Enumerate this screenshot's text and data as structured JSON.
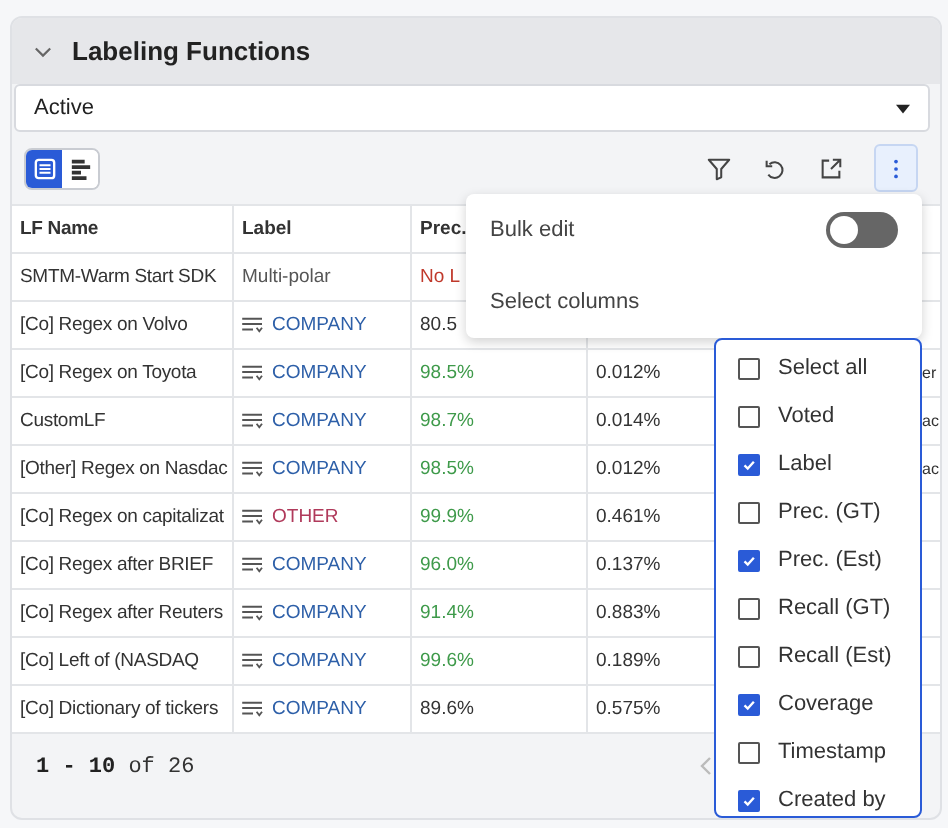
{
  "panel": {
    "title": "Labeling Functions"
  },
  "filter": {
    "value": "Active"
  },
  "view_toggle": [
    {
      "selected": true
    },
    {
      "selected": false
    }
  ],
  "table": {
    "columns": [
      "LF Name",
      "Label",
      "Prec."
    ],
    "rows": [
      {
        "name": "SMTM-Warm Start SDK",
        "label": {
          "text": "Multi-polar",
          "kind": "plain",
          "color": "#555555"
        },
        "prec": {
          "text": "No L",
          "color": "#c0392b"
        }
      },
      {
        "name": "[Co] Regex on Volvo",
        "label": {
          "text": "COMPANY",
          "kind": "tag",
          "color": "#2d5fa8"
        },
        "prec": {
          "text": "80.5",
          "color": "#333333"
        }
      },
      {
        "name": "[Co] Regex on Toyota",
        "label": {
          "text": "COMPANY",
          "kind": "tag",
          "color": "#2d5fa8"
        },
        "prec": {
          "text": "98.5%",
          "color": "#3e9a4a"
        },
        "column_4": "0.012%",
        "column_5": "er"
      },
      {
        "name": "CustomLF",
        "label": {
          "text": "COMPANY",
          "kind": "tag",
          "color": "#2d5fa8"
        },
        "prec": {
          "text": "98.7%",
          "color": "#3e9a4a"
        },
        "column_4": "0.014%",
        "column_5": "ac"
      },
      {
        "name": "[Other] Regex on Nasdac",
        "label": {
          "text": "COMPANY",
          "kind": "tag",
          "color": "#2d5fa8"
        },
        "prec": {
          "text": "98.5%",
          "color": "#3e9a4a"
        },
        "column_4": "0.012%",
        "column_5": "ac"
      },
      {
        "name": "[Co] Regex on capitalizat",
        "label": {
          "text": "OTHER",
          "kind": "tag",
          "color": "#b03a5b"
        },
        "prec": {
          "text": "99.9%",
          "color": "#3e9a4a"
        },
        "column_4": "0.461%"
      },
      {
        "name": "[Co] Regex after BRIEF",
        "label": {
          "text": "COMPANY",
          "kind": "tag",
          "color": "#2d5fa8"
        },
        "prec": {
          "text": "96.0%",
          "color": "#3e9a4a"
        },
        "column_4": "0.137%"
      },
      {
        "name": "[Co] Regex after Reuters",
        "label": {
          "text": "COMPANY",
          "kind": "tag",
          "color": "#2d5fa8"
        },
        "prec": {
          "text": "91.4%",
          "color": "#3e9a4a"
        },
        "column_4": "0.883%"
      },
      {
        "name": "[Co] Left of (NASDAQ",
        "label": {
          "text": "COMPANY",
          "kind": "tag",
          "color": "#2d5fa8"
        },
        "prec": {
          "text": "99.6%",
          "color": "#3e9a4a"
        },
        "column_4": "0.189%"
      },
      {
        "name": "[Co] Dictionary of tickers",
        "label": {
          "text": "COMPANY",
          "kind": "tag",
          "color": "#2d5fa8"
        },
        "prec": {
          "text": "89.6%",
          "color": "#333333"
        },
        "column_4": "0.575%"
      }
    ]
  },
  "pagination": {
    "range": "1 - 10",
    "of": "of 26"
  },
  "menu": {
    "bulk_edit": {
      "label": "Bulk edit",
      "on": false
    },
    "select_columns": "Select columns"
  },
  "column_options": [
    {
      "label": "Select all",
      "checked": false
    },
    {
      "label": "Voted",
      "checked": false
    },
    {
      "label": "Label",
      "checked": true
    },
    {
      "label": "Prec. (GT)",
      "checked": false
    },
    {
      "label": "Prec. (Est)",
      "checked": true
    },
    {
      "label": "Recall (GT)",
      "checked": false
    },
    {
      "label": "Recall (Est)",
      "checked": false
    },
    {
      "label": "Coverage",
      "checked": true
    },
    {
      "label": "Timestamp",
      "checked": false
    },
    {
      "label": "Created by",
      "checked": true
    }
  ]
}
